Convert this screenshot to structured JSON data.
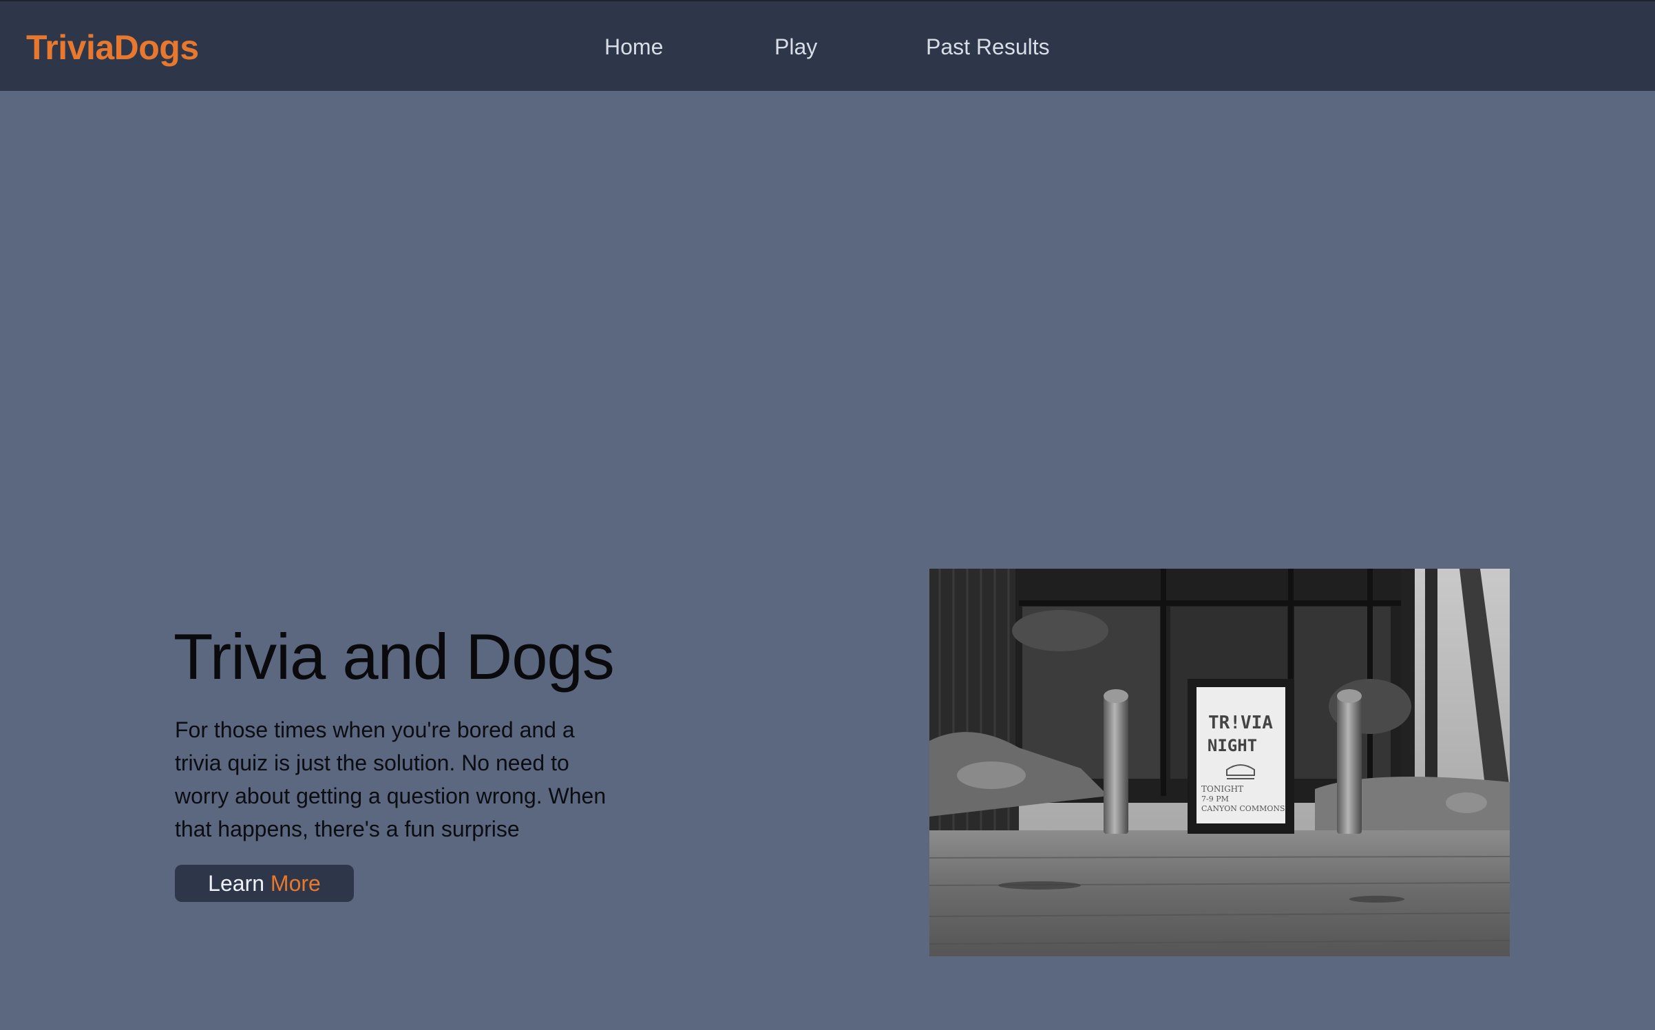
{
  "header": {
    "brand": "TriviaDogs",
    "nav": [
      {
        "label": "Home"
      },
      {
        "label": "Play"
      },
      {
        "label": "Past Results"
      }
    ]
  },
  "hero": {
    "title": "Trivia and Dogs",
    "description": "For those times when you're bored and a trivia quiz is just the solution. No need to worry about getting a question wrong. When that happens, there's a fun surprise",
    "button": {
      "word1": "Learn",
      "word2": "More"
    },
    "image_sign": {
      "line1": "TR!VIA",
      "line2": "NIGHT",
      "line3": "TONIGHT",
      "line4": "7-9 PM",
      "line5": "CANYON COMMONS"
    }
  },
  "colors": {
    "accent": "#e9782f",
    "header_bg": "#2e3749",
    "page_bg": "#5b687f",
    "text_dark": "#0a0a0c",
    "nav_text": "#d8dde6"
  }
}
